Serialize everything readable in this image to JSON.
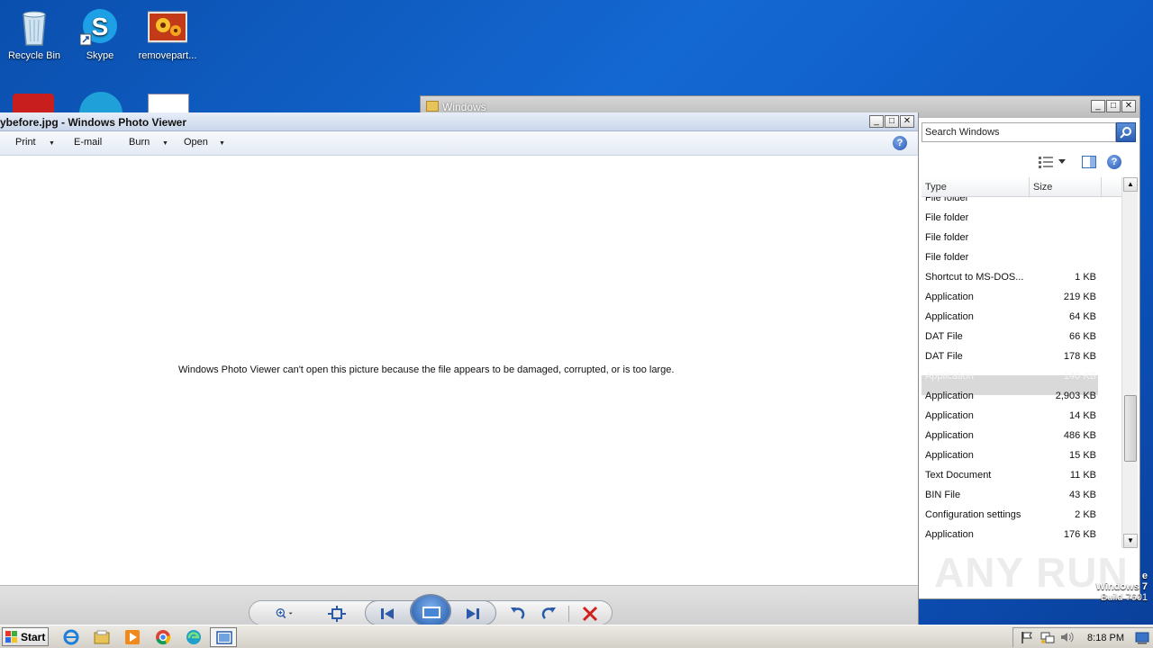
{
  "desktop": {
    "icons": [
      {
        "label": "Recycle Bin",
        "icon": "recycle-bin-icon"
      },
      {
        "label": "Skype",
        "icon": "skype-icon"
      },
      {
        "label": "removepart...",
        "icon": "image-file-icon"
      }
    ],
    "watermark": "ANY RUN",
    "os_name": "Windows 7",
    "os_build": "Build 7601",
    "os_edition_fragment": "e"
  },
  "explorer": {
    "title": "Windows",
    "search_placeholder": "Search Windows",
    "columns": {
      "type": "Type",
      "size": "Size"
    },
    "rows": [
      {
        "type": "File folder",
        "size": ""
      },
      {
        "type": "File folder",
        "size": ""
      },
      {
        "type": "File folder",
        "size": ""
      },
      {
        "type": "File folder",
        "size": ""
      },
      {
        "type": "Shortcut to MS-DOS...",
        "size": "1 KB"
      },
      {
        "type": "Application",
        "size": "219 KB"
      },
      {
        "type": "Application",
        "size": "64 KB"
      },
      {
        "type": "DAT File",
        "size": "66 KB"
      },
      {
        "type": "DAT File",
        "size": "178 KB"
      },
      {
        "type": "Application",
        "size": "140 KB"
      },
      {
        "type": "Application",
        "size": "2,903 KB"
      },
      {
        "type": "Application",
        "size": "14 KB"
      },
      {
        "type": "Application",
        "size": "486 KB"
      },
      {
        "type": "Application",
        "size": "15 KB"
      },
      {
        "type": "Text Document",
        "size": "11 KB"
      },
      {
        "type": "BIN File",
        "size": "43 KB"
      },
      {
        "type": "Configuration settings",
        "size": "2 KB"
      },
      {
        "type": "Application",
        "size": "176 KB"
      }
    ],
    "selected_row": 9
  },
  "photo_viewer": {
    "title": "ybefore.jpg - Windows Photo Viewer",
    "menu": {
      "print": "Print",
      "email": "E-mail",
      "burn": "Burn",
      "open": "Open"
    },
    "help": "?",
    "error_message": "Windows Photo Viewer can't open this picture because the file appears to be damaged, corrupted, or is too large."
  },
  "taskbar": {
    "start_label": "Start",
    "clock": "8:18 PM"
  },
  "colors": {
    "desktop": "#1468d2",
    "selection": "#d9d9d9",
    "delete": "#d02020"
  }
}
